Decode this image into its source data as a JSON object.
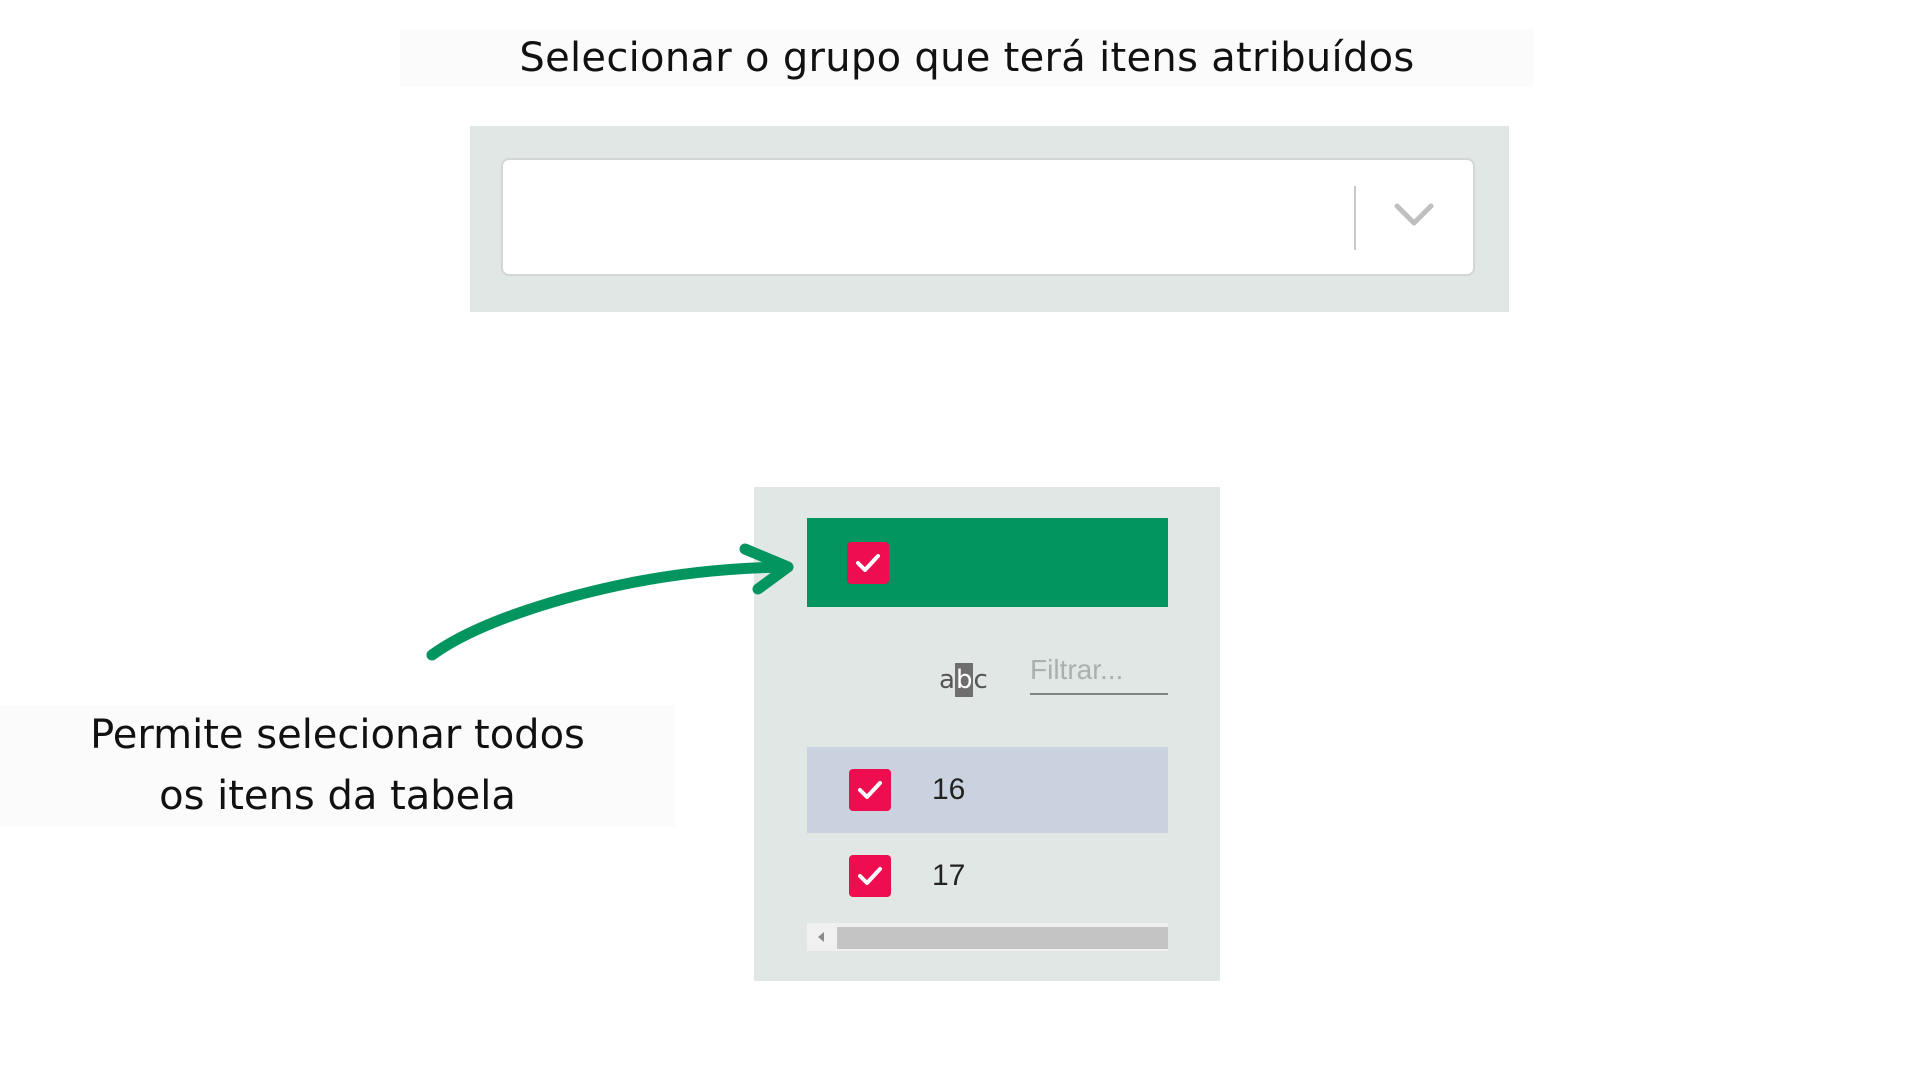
{
  "title": "Selecionar o grupo que terá itens atribuídos",
  "dropdown": {
    "value": "",
    "chevron_icon": "chevron-down-icon"
  },
  "table": {
    "header_checkbox_checked": true,
    "filter": {
      "icon": "abc-filter-icon",
      "icon_parts": [
        "a",
        "b",
        "c"
      ],
      "placeholder": "Filtrar..."
    },
    "rows": [
      {
        "label": "16",
        "checked": true,
        "selected": true
      },
      {
        "label": "17",
        "checked": true,
        "selected": false
      }
    ],
    "scroll_left_icon": "scroll-left-arrow-icon"
  },
  "annotation": {
    "line1": "Permite selecionar todos",
    "line2": "os itens da tabela"
  },
  "colors": {
    "panel_bg": "#e1e7e4",
    "header_green": "#02955f",
    "checkbox_red": "#ee0d4f",
    "selected_row": "#c9d2de",
    "arrow_green": "#02955f"
  }
}
